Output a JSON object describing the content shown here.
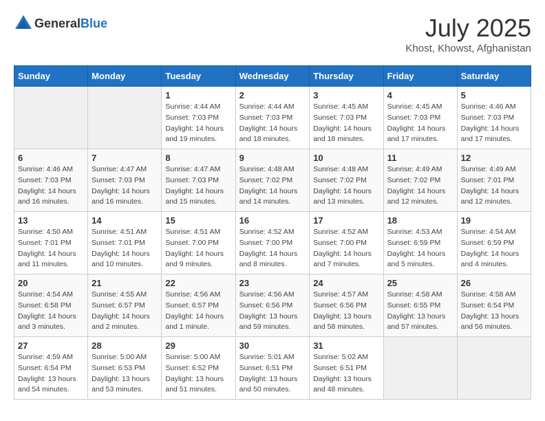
{
  "header": {
    "logo_general": "General",
    "logo_blue": "Blue",
    "month_year": "July 2025",
    "location": "Khost, Khowst, Afghanistan"
  },
  "calendar": {
    "days_of_week": [
      "Sunday",
      "Monday",
      "Tuesday",
      "Wednesday",
      "Thursday",
      "Friday",
      "Saturday"
    ],
    "weeks": [
      [
        {
          "day": "",
          "detail": ""
        },
        {
          "day": "",
          "detail": ""
        },
        {
          "day": "1",
          "detail": "Sunrise: 4:44 AM\nSunset: 7:03 PM\nDaylight: 14 hours and 19 minutes."
        },
        {
          "day": "2",
          "detail": "Sunrise: 4:44 AM\nSunset: 7:03 PM\nDaylight: 14 hours and 18 minutes."
        },
        {
          "day": "3",
          "detail": "Sunrise: 4:45 AM\nSunset: 7:03 PM\nDaylight: 14 hours and 18 minutes."
        },
        {
          "day": "4",
          "detail": "Sunrise: 4:45 AM\nSunset: 7:03 PM\nDaylight: 14 hours and 17 minutes."
        },
        {
          "day": "5",
          "detail": "Sunrise: 4:46 AM\nSunset: 7:03 PM\nDaylight: 14 hours and 17 minutes."
        }
      ],
      [
        {
          "day": "6",
          "detail": "Sunrise: 4:46 AM\nSunset: 7:03 PM\nDaylight: 14 hours and 16 minutes."
        },
        {
          "day": "7",
          "detail": "Sunrise: 4:47 AM\nSunset: 7:03 PM\nDaylight: 14 hours and 16 minutes."
        },
        {
          "day": "8",
          "detail": "Sunrise: 4:47 AM\nSunset: 7:03 PM\nDaylight: 14 hours and 15 minutes."
        },
        {
          "day": "9",
          "detail": "Sunrise: 4:48 AM\nSunset: 7:02 PM\nDaylight: 14 hours and 14 minutes."
        },
        {
          "day": "10",
          "detail": "Sunrise: 4:48 AM\nSunset: 7:02 PM\nDaylight: 14 hours and 13 minutes."
        },
        {
          "day": "11",
          "detail": "Sunrise: 4:49 AM\nSunset: 7:02 PM\nDaylight: 14 hours and 12 minutes."
        },
        {
          "day": "12",
          "detail": "Sunrise: 4:49 AM\nSunset: 7:01 PM\nDaylight: 14 hours and 12 minutes."
        }
      ],
      [
        {
          "day": "13",
          "detail": "Sunrise: 4:50 AM\nSunset: 7:01 PM\nDaylight: 14 hours and 11 minutes."
        },
        {
          "day": "14",
          "detail": "Sunrise: 4:51 AM\nSunset: 7:01 PM\nDaylight: 14 hours and 10 minutes."
        },
        {
          "day": "15",
          "detail": "Sunrise: 4:51 AM\nSunset: 7:00 PM\nDaylight: 14 hours and 9 minutes."
        },
        {
          "day": "16",
          "detail": "Sunrise: 4:52 AM\nSunset: 7:00 PM\nDaylight: 14 hours and 8 minutes."
        },
        {
          "day": "17",
          "detail": "Sunrise: 4:52 AM\nSunset: 7:00 PM\nDaylight: 14 hours and 7 minutes."
        },
        {
          "day": "18",
          "detail": "Sunrise: 4:53 AM\nSunset: 6:59 PM\nDaylight: 14 hours and 5 minutes."
        },
        {
          "day": "19",
          "detail": "Sunrise: 4:54 AM\nSunset: 6:59 PM\nDaylight: 14 hours and 4 minutes."
        }
      ],
      [
        {
          "day": "20",
          "detail": "Sunrise: 4:54 AM\nSunset: 6:58 PM\nDaylight: 14 hours and 3 minutes."
        },
        {
          "day": "21",
          "detail": "Sunrise: 4:55 AM\nSunset: 6:57 PM\nDaylight: 14 hours and 2 minutes."
        },
        {
          "day": "22",
          "detail": "Sunrise: 4:56 AM\nSunset: 6:57 PM\nDaylight: 14 hours and 1 minute."
        },
        {
          "day": "23",
          "detail": "Sunrise: 4:56 AM\nSunset: 6:56 PM\nDaylight: 13 hours and 59 minutes."
        },
        {
          "day": "24",
          "detail": "Sunrise: 4:57 AM\nSunset: 6:56 PM\nDaylight: 13 hours and 58 minutes."
        },
        {
          "day": "25",
          "detail": "Sunrise: 4:58 AM\nSunset: 6:55 PM\nDaylight: 13 hours and 57 minutes."
        },
        {
          "day": "26",
          "detail": "Sunrise: 4:58 AM\nSunset: 6:54 PM\nDaylight: 13 hours and 56 minutes."
        }
      ],
      [
        {
          "day": "27",
          "detail": "Sunrise: 4:59 AM\nSunset: 6:54 PM\nDaylight: 13 hours and 54 minutes."
        },
        {
          "day": "28",
          "detail": "Sunrise: 5:00 AM\nSunset: 6:53 PM\nDaylight: 13 hours and 53 minutes."
        },
        {
          "day": "29",
          "detail": "Sunrise: 5:00 AM\nSunset: 6:52 PM\nDaylight: 13 hours and 51 minutes."
        },
        {
          "day": "30",
          "detail": "Sunrise: 5:01 AM\nSunset: 6:51 PM\nDaylight: 13 hours and 50 minutes."
        },
        {
          "day": "31",
          "detail": "Sunrise: 5:02 AM\nSunset: 6:51 PM\nDaylight: 13 hours and 48 minutes."
        },
        {
          "day": "",
          "detail": ""
        },
        {
          "day": "",
          "detail": ""
        }
      ]
    ]
  }
}
